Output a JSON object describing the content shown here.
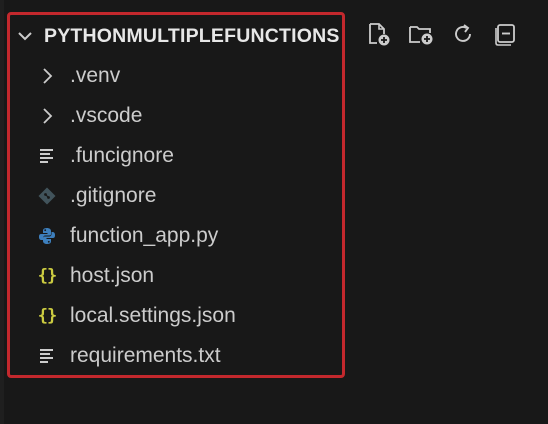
{
  "explorer": {
    "folder_name": "PYTHONMULTIPLEFUNCTIONS",
    "toolbar": [
      {
        "icon": "new-file-icon",
        "name": "new-file-button"
      },
      {
        "icon": "new-folder-icon",
        "name": "new-folder-button"
      },
      {
        "icon": "refresh-icon",
        "name": "refresh-button"
      },
      {
        "icon": "collapse-all-icon",
        "name": "collapse-all-button"
      }
    ],
    "items": [
      {
        "label": ".venv",
        "icon": "chevron-right-icon",
        "kind": "folder"
      },
      {
        "label": ".vscode",
        "icon": "chevron-right-icon",
        "kind": "folder"
      },
      {
        "label": ".funcignore",
        "icon": "text-file-icon",
        "kind": "file"
      },
      {
        "label": ".gitignore",
        "icon": "git-icon",
        "kind": "file"
      },
      {
        "label": "function_app.py",
        "icon": "python-icon",
        "kind": "file"
      },
      {
        "label": "host.json",
        "icon": "json-icon",
        "kind": "file"
      },
      {
        "label": "local.settings.json",
        "icon": "json-icon",
        "kind": "file"
      },
      {
        "label": "requirements.txt",
        "icon": "text-file-icon",
        "kind": "file"
      }
    ]
  },
  "colors": {
    "background": "#181818",
    "text": "#cccccc",
    "highlight_border": "#c3282d",
    "json_icon": "#cbcb41",
    "python_icon": "#3d7fbd",
    "git_icon": "#41535b"
  }
}
